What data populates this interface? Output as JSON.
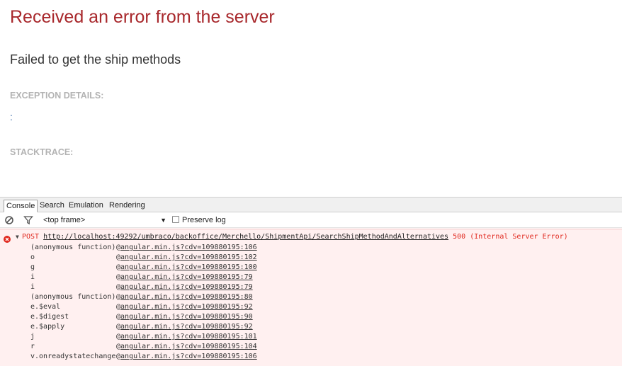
{
  "error_page": {
    "title": "Received an error from the server",
    "message": "Failed to get the ship methods",
    "exception_label": "EXCEPTION DETAILS:",
    "exception_value": ":",
    "stacktrace_label": "STACKTRACE:"
  },
  "devtools": {
    "tabs": [
      {
        "label": "Console",
        "active": true
      },
      {
        "label": "Search",
        "active": false
      },
      {
        "label": "Emulation",
        "active": false
      },
      {
        "label": "Rendering",
        "active": false
      }
    ],
    "toolbar": {
      "frame": "<top frame>",
      "preserve_log": "Preserve log",
      "preserve_checked": false
    },
    "error": {
      "method": "POST",
      "url": "http://localhost:49292/umbraco/backoffice/Merchello/ShipmentApi/SearchShipMethodAndAlternatives",
      "status": "500 (Internal Server Error)"
    },
    "trace": [
      {
        "fn": "(anonymous function)",
        "loc": "angular.min.js?cdv=109880195:106"
      },
      {
        "fn": "o",
        "loc": "angular.min.js?cdv=109880195:102"
      },
      {
        "fn": "g",
        "loc": "angular.min.js?cdv=109880195:100"
      },
      {
        "fn": "i",
        "loc": "angular.min.js?cdv=109880195:79"
      },
      {
        "fn": "i",
        "loc": "angular.min.js?cdv=109880195:79"
      },
      {
        "fn": "(anonymous function)",
        "loc": "angular.min.js?cdv=109880195:80"
      },
      {
        "fn": "e.$eval",
        "loc": "angular.min.js?cdv=109880195:92"
      },
      {
        "fn": "e.$digest",
        "loc": "angular.min.js?cdv=109880195:90"
      },
      {
        "fn": "e.$apply",
        "loc": "angular.min.js?cdv=109880195:92"
      },
      {
        "fn": "j",
        "loc": "angular.min.js?cdv=109880195:101"
      },
      {
        "fn": "r",
        "loc": "angular.min.js?cdv=109880195:104"
      },
      {
        "fn": "v.onreadystatechange",
        "loc": "angular.min.js?cdv=109880195:106"
      }
    ],
    "colors": {
      "error_text": "#e0281e",
      "error_bg": "#fff0f0",
      "title": "#a8282c"
    }
  }
}
